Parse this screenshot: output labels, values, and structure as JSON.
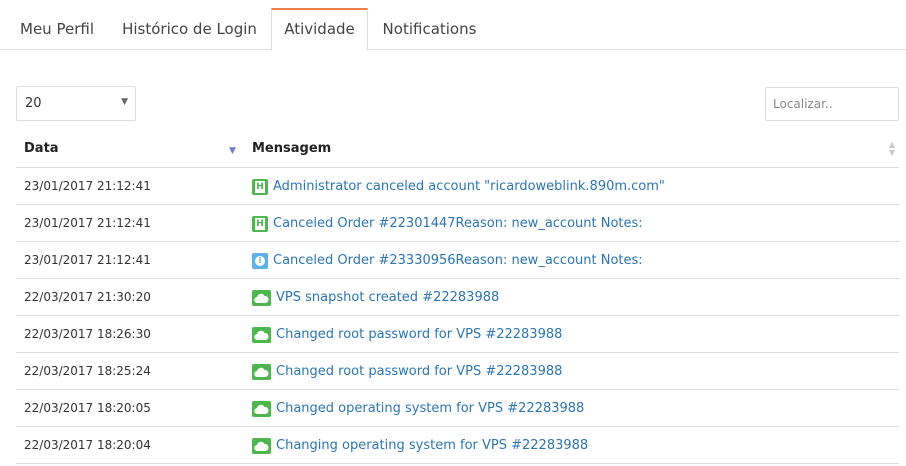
{
  "tabs": [
    {
      "label": "Meu Perfil",
      "active": false
    },
    {
      "label": "Histórico de Login",
      "active": false
    },
    {
      "label": "Atividade",
      "active": true
    },
    {
      "label": "Notifications",
      "active": false
    }
  ],
  "accent_color": "#ee7f4b",
  "link_color": "#2a76b5",
  "page_length": {
    "value": "20"
  },
  "search": {
    "placeholder": "Localizar.."
  },
  "table": {
    "columns": [
      {
        "label": "Data",
        "sort": "descending"
      },
      {
        "label": "Mensagem",
        "sort": "none"
      }
    ],
    "rows": [
      {
        "date": "23/01/2017 21:12:41",
        "icon": "server-icon",
        "message": "Administrator canceled account \"ricardoweblink.890m.com\""
      },
      {
        "date": "23/01/2017 21:12:41",
        "icon": "server-icon",
        "message": "Canceled Order #22301447Reason: new_account Notes:"
      },
      {
        "date": "23/01/2017 21:12:41",
        "icon": "info-icon",
        "message": "Canceled Order #23330956Reason: new_account Notes:"
      },
      {
        "date": "22/03/2017 21:30:20",
        "icon": "cloud-icon",
        "message": "VPS snapshot created #22283988"
      },
      {
        "date": "22/03/2017 18:26:30",
        "icon": "cloud-icon",
        "message": "Changed root password for VPS #22283988"
      },
      {
        "date": "22/03/2017 18:25:24",
        "icon": "cloud-icon",
        "message": "Changed root password for VPS #22283988"
      },
      {
        "date": "22/03/2017 18:20:05",
        "icon": "cloud-icon",
        "message": "Changed operating system for VPS #22283988"
      },
      {
        "date": "22/03/2017 18:20:04",
        "icon": "cloud-icon",
        "message": "Changing operating system for VPS #22283988"
      }
    ]
  }
}
